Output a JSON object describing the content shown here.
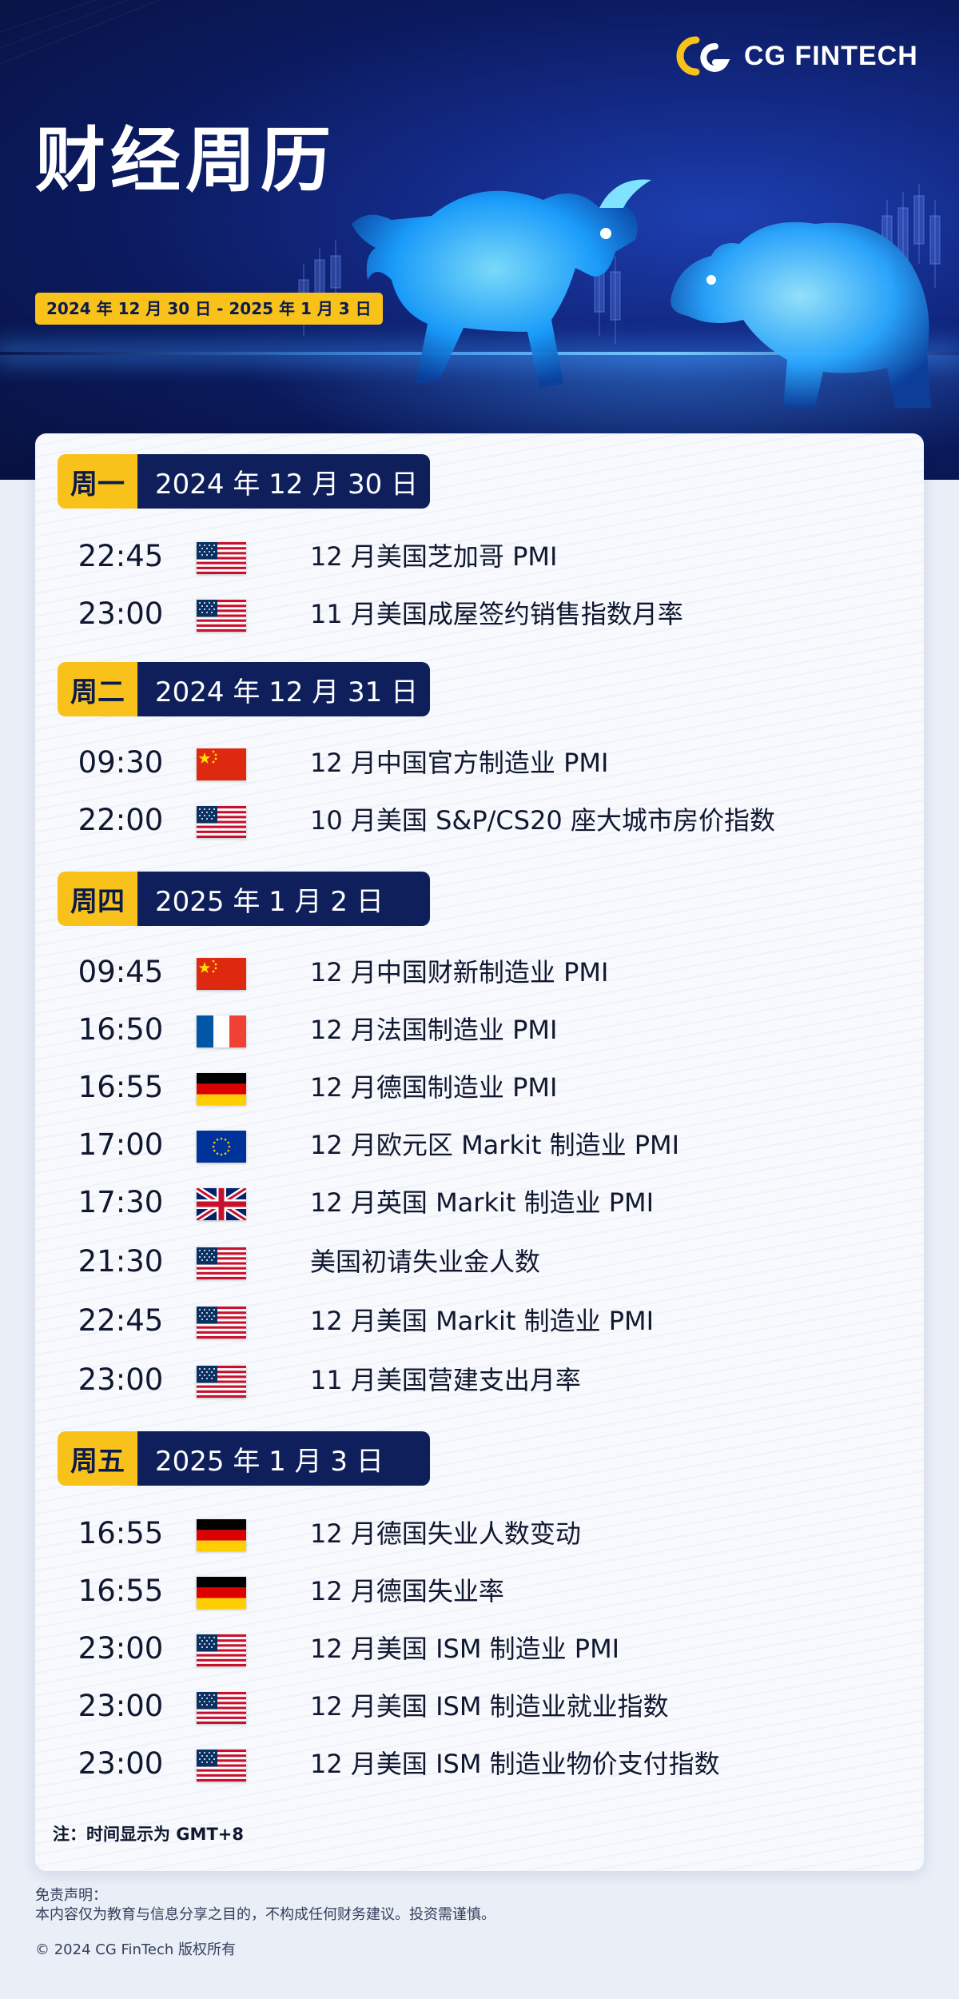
{
  "brand": {
    "name": "CG FINTECH",
    "accent": "#f8c21b",
    "navy": "#0e1f5b"
  },
  "header": {
    "title": "财经周历",
    "date_range": "2024 年 12 月 30 日 - 2025 年 1 月 3 日"
  },
  "days": [
    {
      "day": "周一",
      "date": "2024 年 12 月 30 日",
      "events": [
        {
          "time": "22:45",
          "flag": "us-flag-icon",
          "name": "12 月美国芝加哥 PMI"
        },
        {
          "time": "23:00",
          "flag": "us-flag-icon",
          "name": "11 月美国成屋签约销售指数月率"
        }
      ]
    },
    {
      "day": "周二",
      "date": "2024 年 12 月 31 日",
      "events": [
        {
          "time": "09:30",
          "flag": "cn-flag-icon",
          "name": "12 月中国官方制造业 PMI"
        },
        {
          "time": "22:00",
          "flag": "us-flag-icon",
          "name": "10 月美国 S&P/CS20 座大城市房价指数"
        }
      ]
    },
    {
      "day": "周四",
      "date": "2025 年 1 月 2 日",
      "events": [
        {
          "time": "09:45",
          "flag": "cn-flag-icon",
          "name": "12 月中国财新制造业 PMI"
        },
        {
          "time": "16:50",
          "flag": "fr-flag-icon",
          "name": "12 月法国制造业 PMI"
        },
        {
          "time": "16:55",
          "flag": "de-flag-icon",
          "name": "12 月德国制造业 PMI"
        },
        {
          "time": "17:00",
          "flag": "eu-flag-icon",
          "name": "12 月欧元区 Markit 制造业 PMI"
        },
        {
          "time": "17:30",
          "flag": "uk-flag-icon",
          "name": "12 月英国 Markit 制造业 PMI"
        },
        {
          "time": "21:30",
          "flag": "us-flag-icon",
          "name": "美国初请失业金人数"
        },
        {
          "time": "22:45",
          "flag": "us-flag-icon",
          "name": "12 月美国 Markit 制造业 PMI"
        },
        {
          "time": "23:00",
          "flag": "us-flag-icon",
          "name": "11 月美国营建支出月率"
        }
      ]
    },
    {
      "day": "周五",
      "date": "2025 年 1 月 3 日",
      "events": [
        {
          "time": "16:55",
          "flag": "de-flag-icon",
          "name": "12 月德国失业人数变动"
        },
        {
          "time": "16:55",
          "flag": "de-flag-icon",
          "name": "12 月德国失业率"
        },
        {
          "time": "23:00",
          "flag": "us-flag-icon",
          "name": "12 月美国 ISM 制造业 PMI"
        },
        {
          "time": "23:00",
          "flag": "us-flag-icon",
          "name": "12 月美国 ISM 制造业就业指数"
        },
        {
          "time": "23:00",
          "flag": "us-flag-icon",
          "name": "12 月美国 ISM 制造业物价支付指数"
        }
      ]
    }
  ],
  "note": "注：时间显示为 GMT+8",
  "footer": {
    "disclaimer_title": "免责声明：",
    "disclaimer_body": "本内容仅为教育与信息分享之目的，不构成任何财务建议。投资需谨慎。",
    "copyright": "© 2024 CG FinTech 版权所有"
  }
}
